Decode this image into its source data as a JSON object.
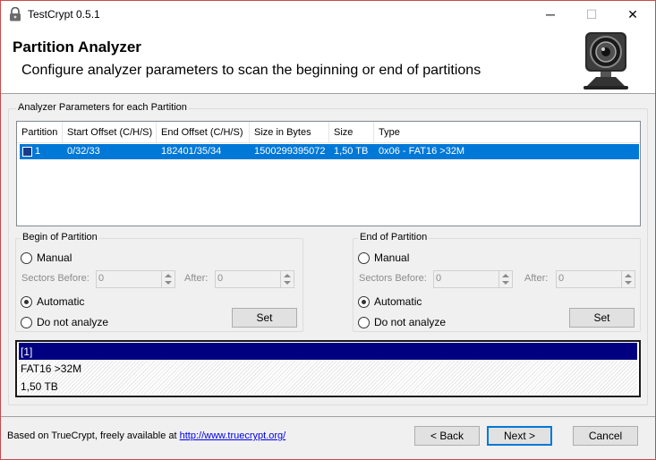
{
  "window": {
    "title": "TestCrypt 0.5.1",
    "controls": {
      "minimize": "─",
      "maximize": "☐",
      "close": "✕"
    }
  },
  "header": {
    "title": "Partition Analyzer",
    "subtitle": "Configure analyzer parameters to scan the beginning or end of partitions",
    "icon": "webcam-icon"
  },
  "analyzer_group": {
    "legend": "Analyzer Parameters for each Partition",
    "columns": [
      "Partition",
      "Start Offset (C/H/S)",
      "End Offset (C/H/S)",
      "Size in Bytes",
      "Size",
      "Type"
    ],
    "rows": [
      {
        "checked": true,
        "partition": "1",
        "start": "0/32/33",
        "end": "182401/35/34",
        "bytes": "1500299395072",
        "size": "1,50 TB",
        "type": "0x06 - FAT16 >32M"
      }
    ]
  },
  "begin_group": {
    "legend": "Begin of Partition",
    "manual": "Manual",
    "sectors_before_label": "Sectors Before:",
    "sectors_before_value": "0",
    "after_label": "After:",
    "after_value": "0",
    "automatic": "Automatic",
    "do_not_analyze": "Do not analyze",
    "set": "Set",
    "selected": "Automatic"
  },
  "end_group": {
    "legend": "End of Partition",
    "manual": "Manual",
    "sectors_before_label": "Sectors Before:",
    "sectors_before_value": "0",
    "after_label": "After:",
    "after_value": "0",
    "automatic": "Automatic",
    "do_not_analyze": "Do not analyze",
    "set": "Set",
    "selected": "Automatic"
  },
  "info": {
    "lines": [
      "[1]",
      "FAT16 >32M",
      "1,50 TB"
    ]
  },
  "footer": {
    "text": "Based on TrueCrypt, freely available at",
    "link": "http://www.truecrypt.org/",
    "back": "< Back",
    "next": "Next >",
    "cancel": "Cancel"
  },
  "colors": {
    "selection": "#0078d7",
    "info_selection": "#000080",
    "default_button_border": "#0078d7"
  }
}
